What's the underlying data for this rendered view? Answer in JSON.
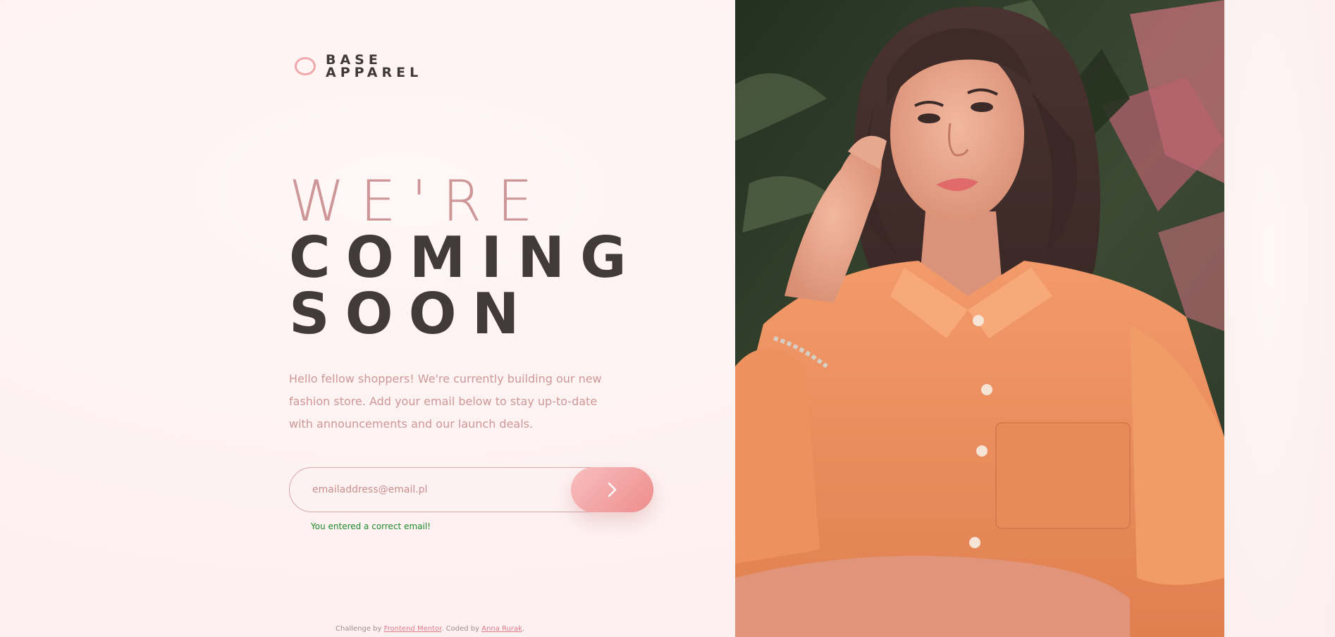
{
  "brand": {
    "line1": "BASE",
    "line2": "APPAREL"
  },
  "headline": {
    "line1": "WE'RE",
    "line2": "COMING",
    "line3": "SOON"
  },
  "description": "Hello fellow shoppers! We're currently building our new fashion store. Add your email below to stay up-to-date with announcements and our launch deals.",
  "email_form": {
    "placeholder": "emailaddress@email.pl",
    "value": "",
    "submit_icon": "chevron-right-icon"
  },
  "feedback": {
    "message": "You entered a correct email!",
    "status_color": "#1f8a2a"
  },
  "attribution": {
    "prefix": "Challenge by",
    "link1_label": "Frontend Mentor",
    "middle": ". Coded by",
    "link2_label": "Anna Rurak",
    "suffix": "."
  },
  "colors": {
    "accent": "#ce9797",
    "dark_text": "#423a3a",
    "button_gradient_start": "#f8bfbf",
    "button_gradient_end": "#ee8c8c",
    "background": "#fdf1f1"
  },
  "hero": {
    "image_subject": "woman in orange shirt in front of tropical leaves"
  }
}
